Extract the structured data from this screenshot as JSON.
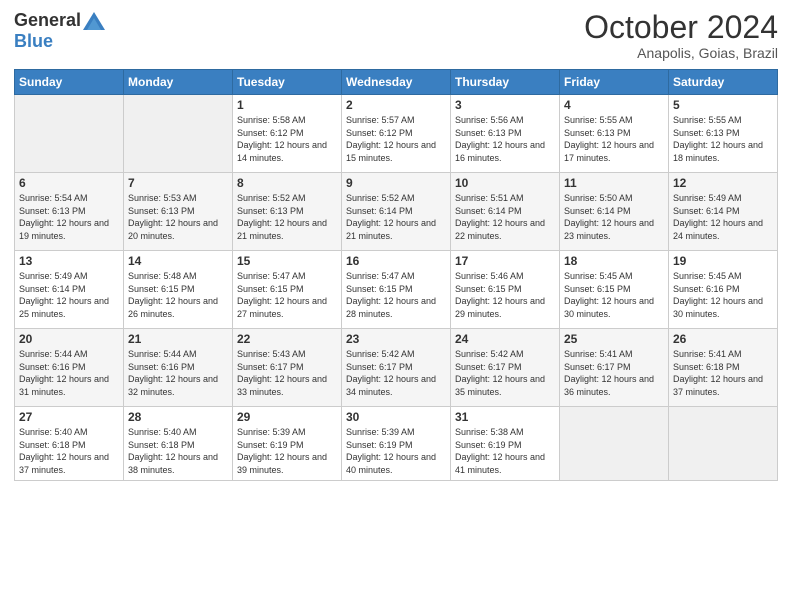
{
  "logo": {
    "general": "General",
    "blue": "Blue"
  },
  "title": {
    "month_year": "October 2024",
    "location": "Anapolis, Goias, Brazil"
  },
  "weekdays": [
    "Sunday",
    "Monday",
    "Tuesday",
    "Wednesday",
    "Thursday",
    "Friday",
    "Saturday"
  ],
  "weeks": [
    [
      {
        "day": "",
        "empty": true
      },
      {
        "day": "",
        "empty": true
      },
      {
        "day": "1",
        "sunrise": "5:58 AM",
        "sunset": "6:12 PM",
        "daylight": "12 hours and 14 minutes."
      },
      {
        "day": "2",
        "sunrise": "5:57 AM",
        "sunset": "6:12 PM",
        "daylight": "12 hours and 15 minutes."
      },
      {
        "day": "3",
        "sunrise": "5:56 AM",
        "sunset": "6:13 PM",
        "daylight": "12 hours and 16 minutes."
      },
      {
        "day": "4",
        "sunrise": "5:55 AM",
        "sunset": "6:13 PM",
        "daylight": "12 hours and 17 minutes."
      },
      {
        "day": "5",
        "sunrise": "5:55 AM",
        "sunset": "6:13 PM",
        "daylight": "12 hours and 18 minutes."
      }
    ],
    [
      {
        "day": "6",
        "sunrise": "5:54 AM",
        "sunset": "6:13 PM",
        "daylight": "12 hours and 19 minutes."
      },
      {
        "day": "7",
        "sunrise": "5:53 AM",
        "sunset": "6:13 PM",
        "daylight": "12 hours and 20 minutes."
      },
      {
        "day": "8",
        "sunrise": "5:52 AM",
        "sunset": "6:13 PM",
        "daylight": "12 hours and 21 minutes."
      },
      {
        "day": "9",
        "sunrise": "5:52 AM",
        "sunset": "6:14 PM",
        "daylight": "12 hours and 21 minutes."
      },
      {
        "day": "10",
        "sunrise": "5:51 AM",
        "sunset": "6:14 PM",
        "daylight": "12 hours and 22 minutes."
      },
      {
        "day": "11",
        "sunrise": "5:50 AM",
        "sunset": "6:14 PM",
        "daylight": "12 hours and 23 minutes."
      },
      {
        "day": "12",
        "sunrise": "5:49 AM",
        "sunset": "6:14 PM",
        "daylight": "12 hours and 24 minutes."
      }
    ],
    [
      {
        "day": "13",
        "sunrise": "5:49 AM",
        "sunset": "6:14 PM",
        "daylight": "12 hours and 25 minutes."
      },
      {
        "day": "14",
        "sunrise": "5:48 AM",
        "sunset": "6:15 PM",
        "daylight": "12 hours and 26 minutes."
      },
      {
        "day": "15",
        "sunrise": "5:47 AM",
        "sunset": "6:15 PM",
        "daylight": "12 hours and 27 minutes."
      },
      {
        "day": "16",
        "sunrise": "5:47 AM",
        "sunset": "6:15 PM",
        "daylight": "12 hours and 28 minutes."
      },
      {
        "day": "17",
        "sunrise": "5:46 AM",
        "sunset": "6:15 PM",
        "daylight": "12 hours and 29 minutes."
      },
      {
        "day": "18",
        "sunrise": "5:45 AM",
        "sunset": "6:15 PM",
        "daylight": "12 hours and 30 minutes."
      },
      {
        "day": "19",
        "sunrise": "5:45 AM",
        "sunset": "6:16 PM",
        "daylight": "12 hours and 30 minutes."
      }
    ],
    [
      {
        "day": "20",
        "sunrise": "5:44 AM",
        "sunset": "6:16 PM",
        "daylight": "12 hours and 31 minutes."
      },
      {
        "day": "21",
        "sunrise": "5:44 AM",
        "sunset": "6:16 PM",
        "daylight": "12 hours and 32 minutes."
      },
      {
        "day": "22",
        "sunrise": "5:43 AM",
        "sunset": "6:17 PM",
        "daylight": "12 hours and 33 minutes."
      },
      {
        "day": "23",
        "sunrise": "5:42 AM",
        "sunset": "6:17 PM",
        "daylight": "12 hours and 34 minutes."
      },
      {
        "day": "24",
        "sunrise": "5:42 AM",
        "sunset": "6:17 PM",
        "daylight": "12 hours and 35 minutes."
      },
      {
        "day": "25",
        "sunrise": "5:41 AM",
        "sunset": "6:17 PM",
        "daylight": "12 hours and 36 minutes."
      },
      {
        "day": "26",
        "sunrise": "5:41 AM",
        "sunset": "6:18 PM",
        "daylight": "12 hours and 37 minutes."
      }
    ],
    [
      {
        "day": "27",
        "sunrise": "5:40 AM",
        "sunset": "6:18 PM",
        "daylight": "12 hours and 37 minutes."
      },
      {
        "day": "28",
        "sunrise": "5:40 AM",
        "sunset": "6:18 PM",
        "daylight": "12 hours and 38 minutes."
      },
      {
        "day": "29",
        "sunrise": "5:39 AM",
        "sunset": "6:19 PM",
        "daylight": "12 hours and 39 minutes."
      },
      {
        "day": "30",
        "sunrise": "5:39 AM",
        "sunset": "6:19 PM",
        "daylight": "12 hours and 40 minutes."
      },
      {
        "day": "31",
        "sunrise": "5:38 AM",
        "sunset": "6:19 PM",
        "daylight": "12 hours and 41 minutes."
      },
      {
        "day": "",
        "empty": true
      },
      {
        "day": "",
        "empty": true
      }
    ]
  ]
}
